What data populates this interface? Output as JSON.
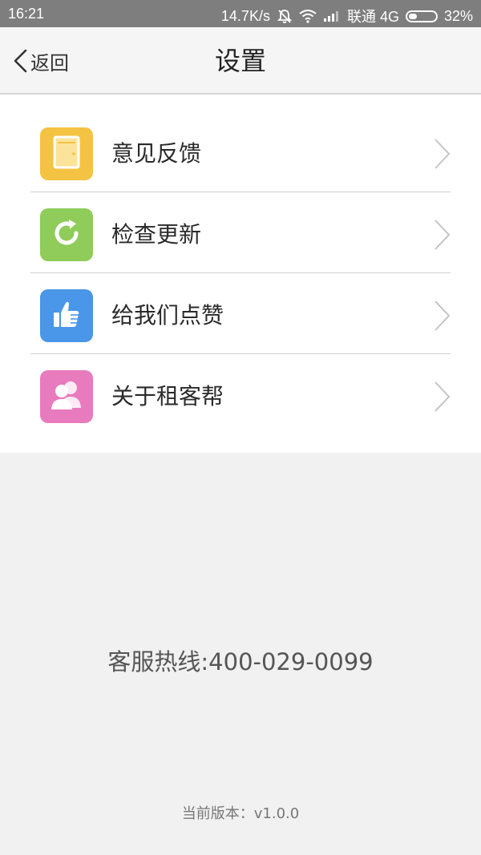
{
  "status_bar": {
    "time": "16:21",
    "net_speed": "14.7K/s",
    "carrier": "联通 4G",
    "battery": "32%",
    "battery_level": 0.32
  },
  "nav": {
    "back_label": "返回",
    "title": "设置"
  },
  "menu": {
    "items": [
      {
        "label": "意见反馈",
        "icon": "feedback-door-icon",
        "color": "#f5c343"
      },
      {
        "label": "检查更新",
        "icon": "refresh-icon",
        "color": "#8fcc5a"
      },
      {
        "label": "给我们点赞",
        "icon": "thumbs-up-icon",
        "color": "#4a96e8"
      },
      {
        "label": "关于租客帮",
        "icon": "users-icon",
        "color": "#e87bbd"
      }
    ]
  },
  "footer": {
    "hotline": "客服热线:400-029-0099",
    "version": "当前版本：v1.0.0"
  }
}
